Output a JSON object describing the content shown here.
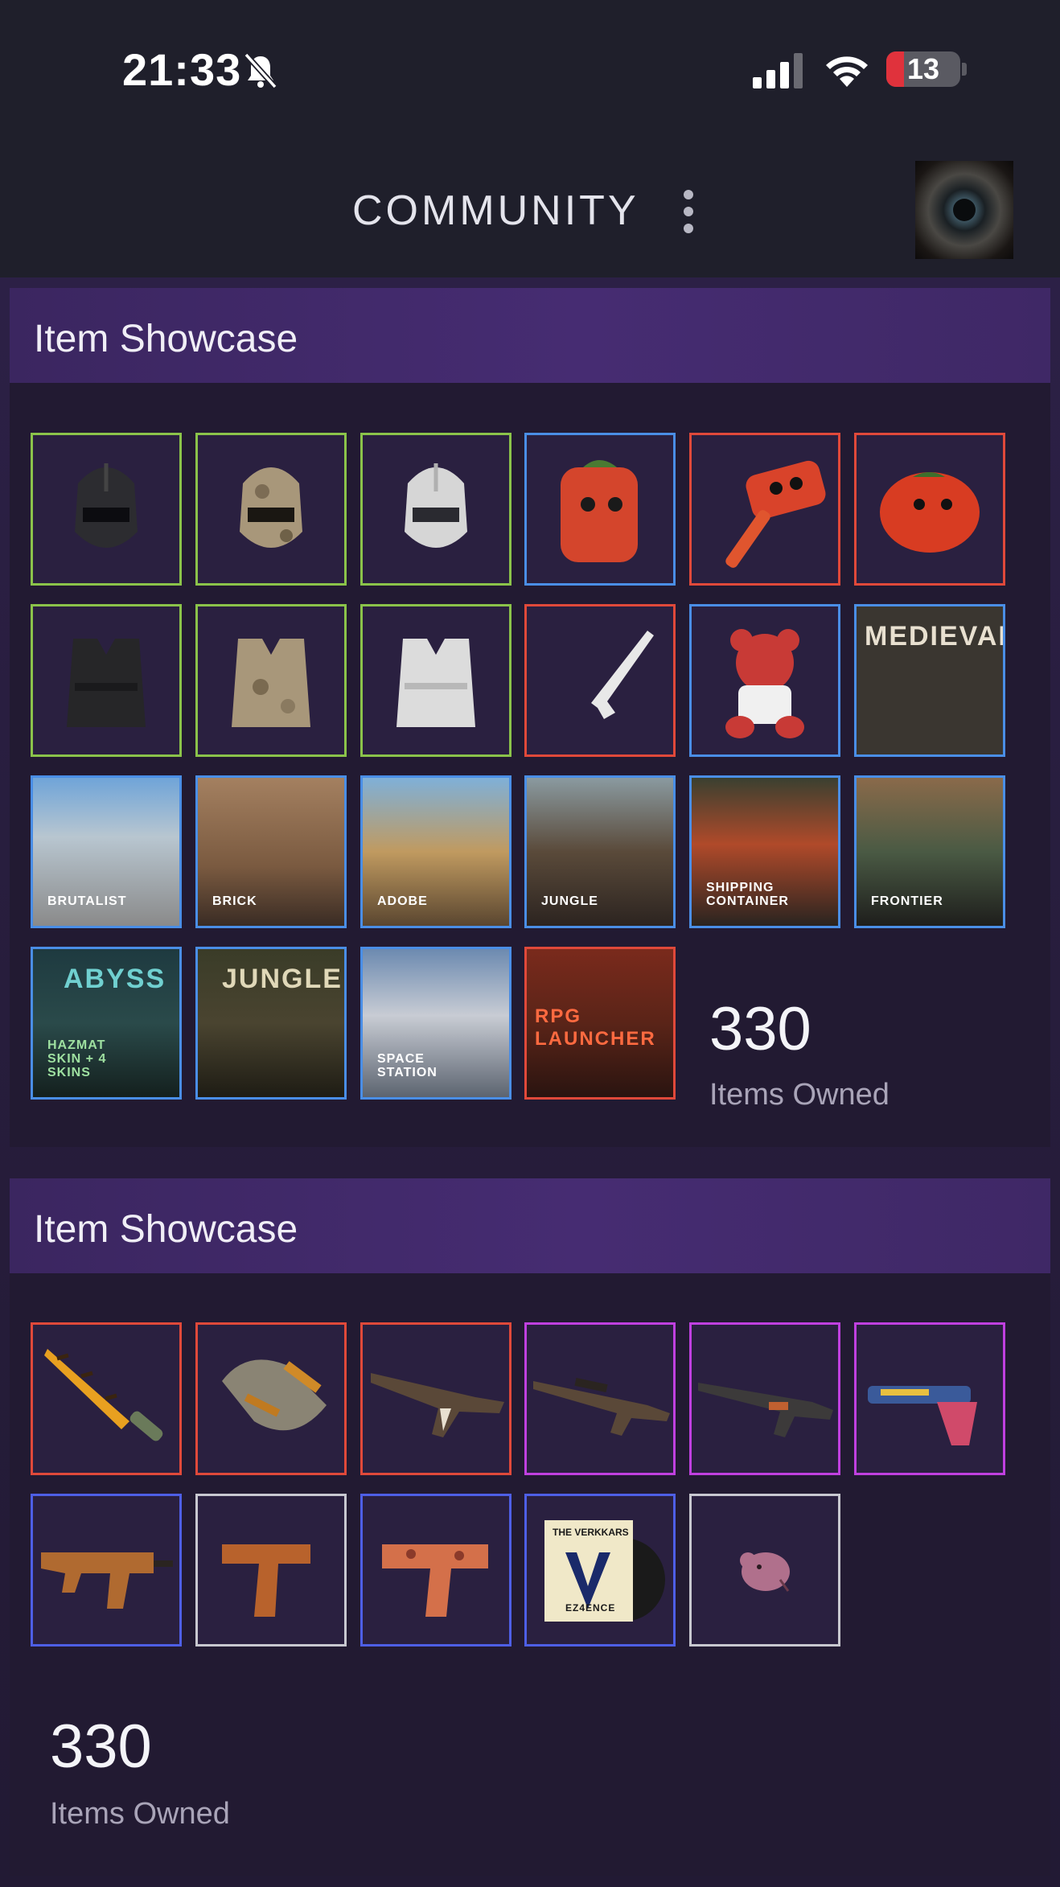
{
  "status_bar": {
    "time": "21:33",
    "battery": "13"
  },
  "header": {
    "title": "COMMUNITY"
  },
  "showcases": [
    {
      "title": "Item Showcase",
      "count": "330",
      "count_label": "Items Owned",
      "tiles": [
        {
          "name": "black facemask",
          "rarity_color": "#8bc34a"
        },
        {
          "name": "camo facemask",
          "rarity_color": "#8bc34a"
        },
        {
          "name": "white facemask",
          "rarity_color": "#8bc34a"
        },
        {
          "name": "tomato backpack",
          "rarity_color": "#4a8ee6"
        },
        {
          "name": "tomato hammer",
          "rarity_color": "#e0493a"
        },
        {
          "name": "tomato head",
          "rarity_color": "#e0493a"
        },
        {
          "name": "black chestplate",
          "rarity_color": "#8bc34a"
        },
        {
          "name": "camo chestplate",
          "rarity_color": "#8bc34a"
        },
        {
          "name": "white chestplate",
          "rarity_color": "#8bc34a"
        },
        {
          "name": "white rifle",
          "rarity_color": "#e0493a"
        },
        {
          "name": "teddy bear",
          "rarity_color": "#4a8ee6"
        },
        {
          "name": "medieval pack",
          "rarity_color": "#4a8ee6",
          "banner": "MEDIEVAL"
        },
        {
          "name": "brutalist",
          "rarity_color": "#4a8ee6",
          "caption": "BRUTALIST"
        },
        {
          "name": "brick",
          "rarity_color": "#4a8ee6",
          "caption": "BRICK"
        },
        {
          "name": "adobe",
          "rarity_color": "#4a8ee6",
          "caption": "ADOBE"
        },
        {
          "name": "jungle",
          "rarity_color": "#4a8ee6",
          "caption": "JUNGLE"
        },
        {
          "name": "shipping container",
          "rarity_color": "#4a8ee6",
          "caption": "SHIPPING CONTAINER"
        },
        {
          "name": "frontier",
          "rarity_color": "#4a8ee6",
          "caption": "FRONTIER"
        },
        {
          "name": "abyss pack",
          "rarity_color": "#4a8ee6",
          "banner": "ABYSS",
          "caption": "HAZMAT SKIN + 4 SKINS"
        },
        {
          "name": "jungle pack",
          "rarity_color": "#4a8ee6",
          "banner": "JUNGLE"
        },
        {
          "name": "space station",
          "rarity_color": "#4a8ee6",
          "caption": "SPACE STATION"
        },
        {
          "name": "rpg launcher",
          "rarity_color": "#e0493a",
          "banner": "RPG LAUNCHER"
        }
      ]
    },
    {
      "title": "Item Showcase",
      "count": "330",
      "count_label": "Items Owned",
      "tiles": [
        {
          "name": "tiger knife",
          "rarity_color": "#e0493a"
        },
        {
          "name": "gloves",
          "rarity_color": "#e0493a"
        },
        {
          "name": "ak rifle",
          "rarity_color": "#e0493a"
        },
        {
          "name": "sniper rifle",
          "rarity_color": "#c040e0"
        },
        {
          "name": "m4 rifle",
          "rarity_color": "#c040e0"
        },
        {
          "name": "silenced pistol",
          "rarity_color": "#c040e0"
        },
        {
          "name": "smg",
          "rarity_color": "#4e5fe6"
        },
        {
          "name": "cz pistol",
          "rarity_color": "#c8c8d0"
        },
        {
          "name": "glock pistol",
          "rarity_color": "#4e5fe6"
        },
        {
          "name": "music kit",
          "rarity_color": "#4e5fe6",
          "banner": "THE VERKKARS",
          "caption": "EZ4ENCE"
        },
        {
          "name": "pig sticker",
          "rarity_color": "#c8c8d0"
        }
      ]
    }
  ]
}
